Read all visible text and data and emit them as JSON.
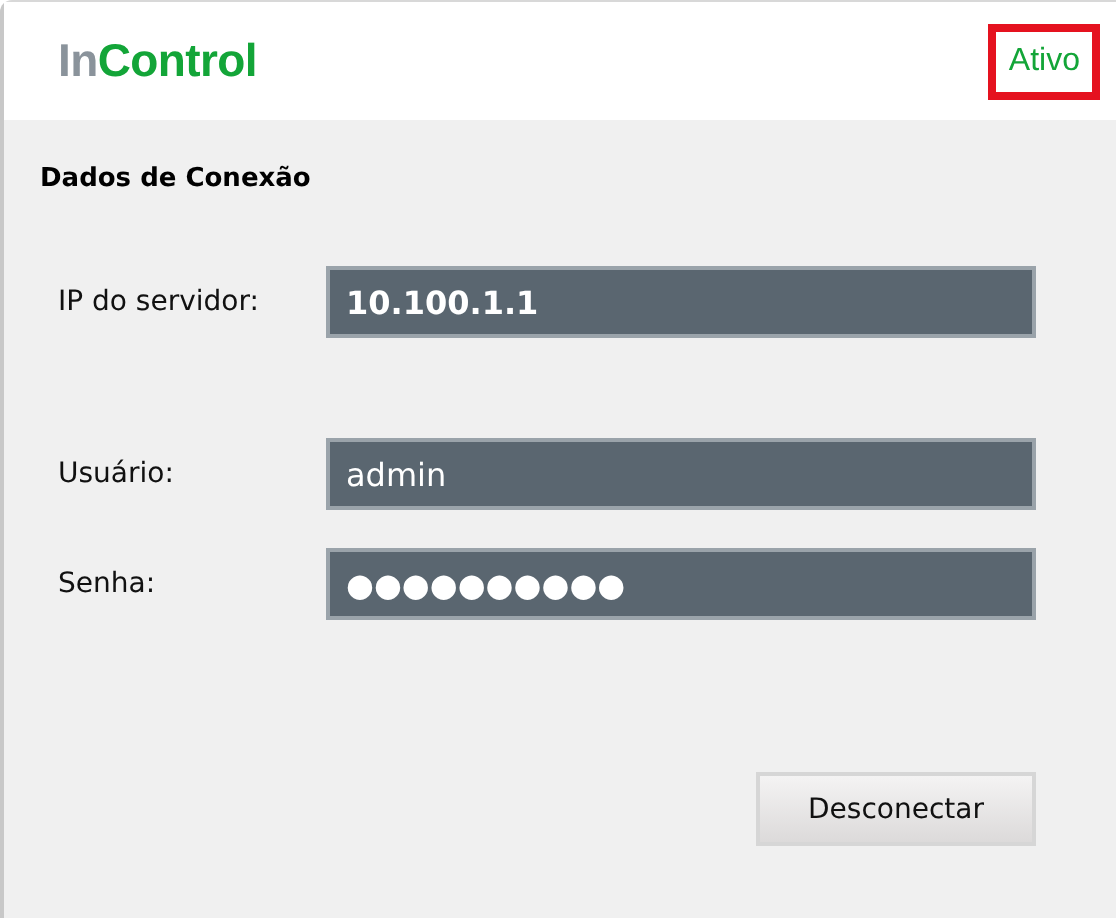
{
  "header": {
    "logo": {
      "prefix": "In",
      "name": "Control"
    },
    "status": {
      "label": "Ativo",
      "highlighted": true
    }
  },
  "panel": {
    "title": "Dados de Conexão",
    "field_groups": [
      [
        {
          "label": "IP do servidor:",
          "value": "10.100.1.1"
        }
      ],
      [
        {
          "label": "Usuário:",
          "value": "admin"
        },
        {
          "label": "Senha:",
          "value": "●●●●●●●●●●"
        }
      ]
    ],
    "buttons": [
      "Desconectar"
    ]
  }
}
